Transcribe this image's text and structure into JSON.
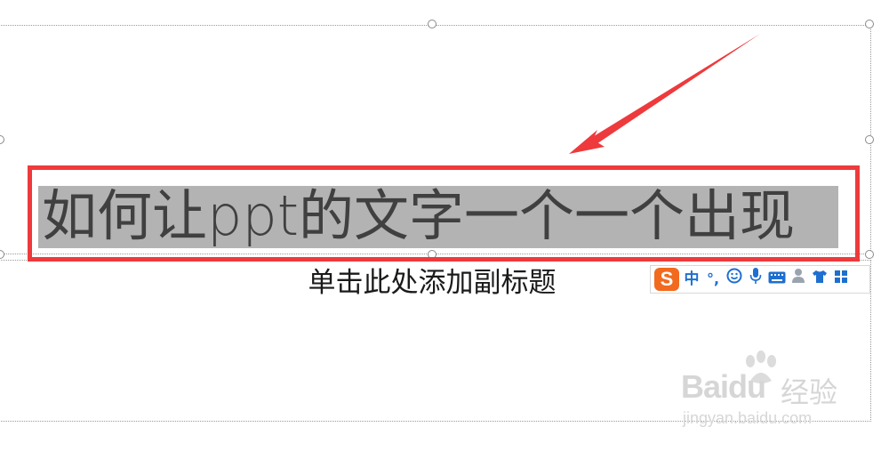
{
  "slide": {
    "title": "如何让ppt的文字一个一个出现",
    "subtitle_placeholder": "单击此处添加副标题"
  },
  "ime_toolbar": {
    "logo": "S",
    "mode": "中",
    "punct": "°,",
    "items": [
      "emoji-icon",
      "microphone-icon",
      "keyboard-icon",
      "user-icon",
      "skin-icon",
      "toolbox-icon"
    ]
  },
  "annotation": {
    "highlight_color": "#ee3a3c"
  },
  "watermark": {
    "brand": "Baidu",
    "brand_cn": "经验",
    "url": "jingyan.baidu.com"
  }
}
